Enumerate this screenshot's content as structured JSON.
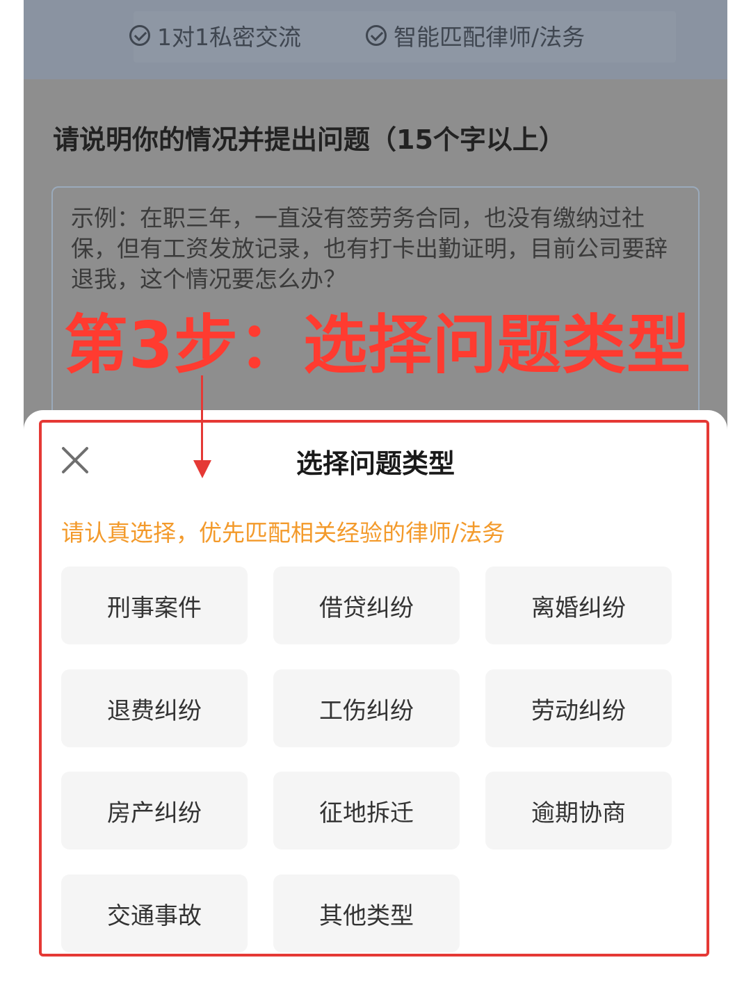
{
  "features": [
    {
      "label": "1对1私密交流",
      "icon": "check-circle-icon"
    },
    {
      "label": "智能匹配律师/法务",
      "icon": "check-circle-icon"
    }
  ],
  "question": {
    "prompt": "请说明你的情况并提出问题（15个字以上）",
    "placeholder": "示例：在职三年，一直没有签劳务合同，也没有缴纳过社保，但有工资发放记录，也有打卡出勤证明，目前公司要辞退我，这个情况要怎么办？"
  },
  "annotation": {
    "step_text": "第3步：选择问题类型",
    "color": "#ff3b30"
  },
  "sheet": {
    "title": "选择问题类型",
    "hint": "请认真选择，优先匹配相关经验的律师/法务",
    "types": [
      "刑事案件",
      "借贷纠纷",
      "离婚纠纷",
      "退费纠纷",
      "工伤纠纷",
      "劳动纠纷",
      "房产纠纷",
      "征地拆迁",
      "逾期协商",
      "交通事故",
      "其他类型"
    ]
  },
  "colors": {
    "hint": "#f39a2b",
    "highlight": "#e53935"
  }
}
